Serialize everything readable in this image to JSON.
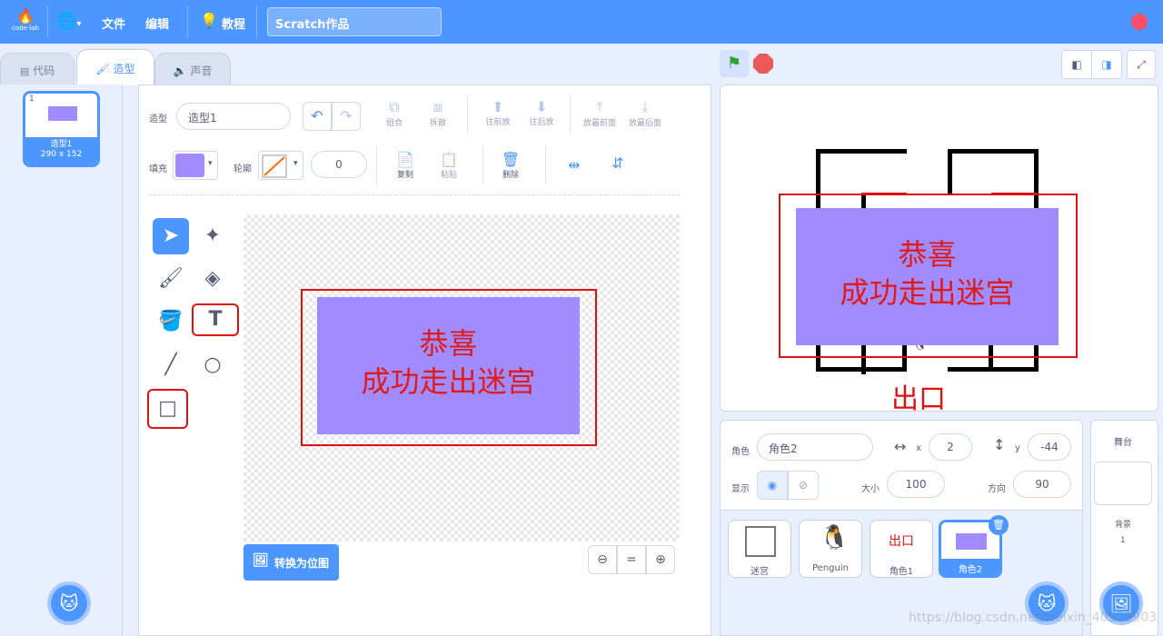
{
  "topbar": {
    "logo_text": "code·lab",
    "file": "文件",
    "edit": "编辑",
    "tutorial": "教程",
    "project_title": "Scratch作品"
  },
  "tabs": {
    "code": "代码",
    "costumes": "造型",
    "sounds": "声音"
  },
  "costume_list": {
    "items": [
      {
        "index": "1",
        "name": "造型1",
        "size": "290 x 152"
      }
    ]
  },
  "editor": {
    "costume_label": "造型",
    "costume_name": "造型1",
    "fill_label": "填充",
    "fill_color": "#a18cff",
    "outline_label": "轮廓",
    "outline_width": "0",
    "tools_row1": [
      "组合",
      "拆散",
      "往前放",
      "往后放",
      "放最前面",
      "放最后面"
    ],
    "copy": "复制",
    "paste": "粘贴",
    "delete": "删除",
    "canvas_text_line1": "恭喜",
    "canvas_text_line2": "成功走出迷宫",
    "convert_button": "转换为位图",
    "zoom_in": "+",
    "zoom_reset": "=",
    "zoom_out": "−"
  },
  "stage": {
    "text_line1": "恭喜",
    "text_line2": "成功走出迷宫",
    "exit_label": "出口"
  },
  "sprite_info": {
    "sprite_label": "角色",
    "sprite_name": "角色2",
    "x_label": "x",
    "x_value": "2",
    "y_label": "y",
    "y_value": "-44",
    "show_label": "显示",
    "size_label": "大小",
    "size_value": "100",
    "direction_label": "方向",
    "direction_value": "90"
  },
  "sprites": [
    {
      "name": "迷宫"
    },
    {
      "name": "Penguin"
    },
    {
      "name": "角色1",
      "thumb_text": "出口"
    },
    {
      "name": "角色2"
    }
  ],
  "stage_pane": {
    "title": "舞台",
    "backdrop_label": "背景",
    "backdrop_count": "1"
  },
  "watermark": "https://blog.csdn.net/weixin_40523903"
}
